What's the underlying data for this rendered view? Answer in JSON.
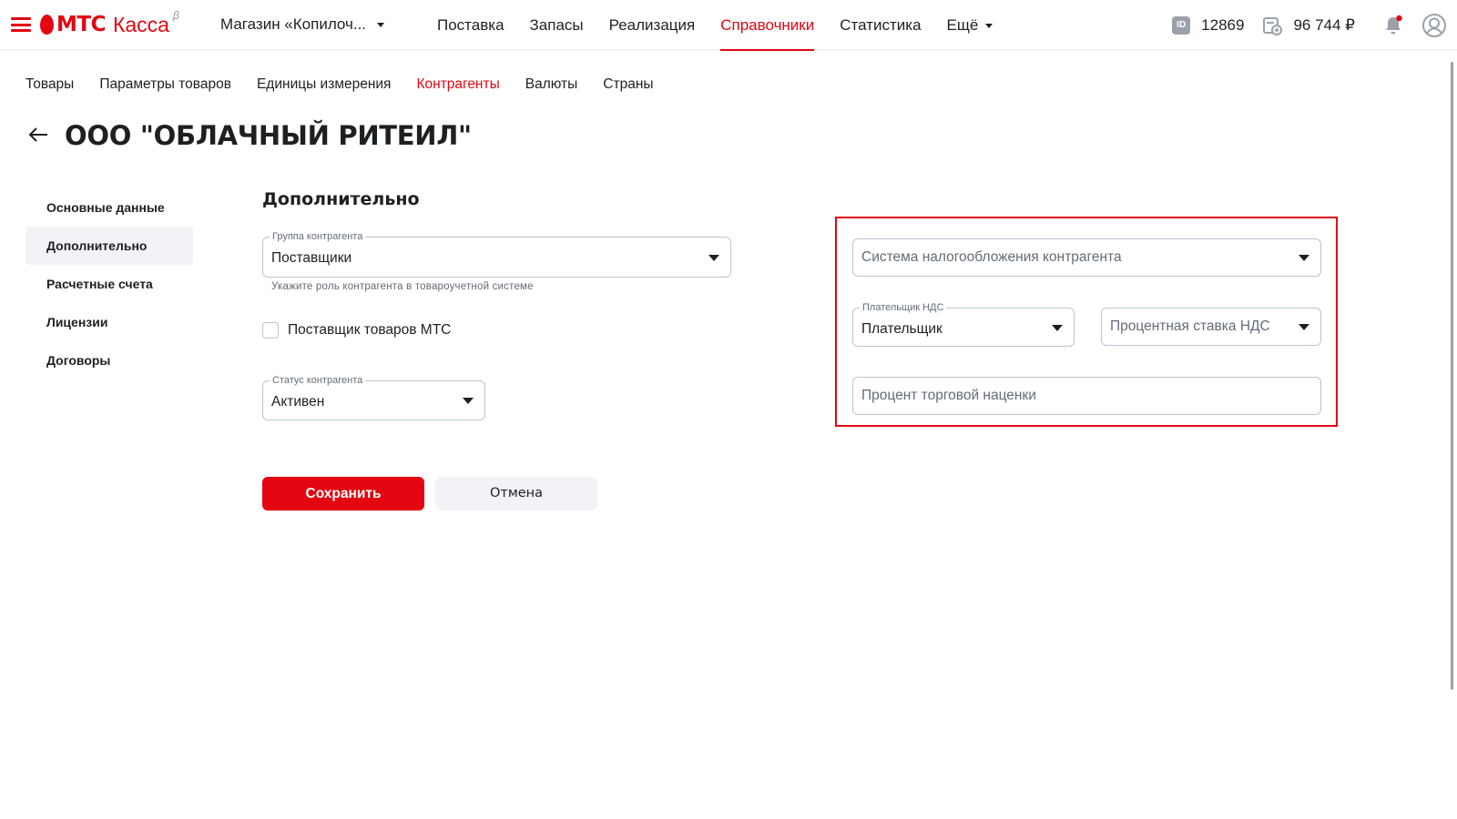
{
  "header": {
    "logo_brand": "МТС",
    "logo_product": "Касса",
    "logo_beta": "β",
    "store_name": "Магазин «Копилоч...",
    "nav": [
      {
        "label": "Поставка"
      },
      {
        "label": "Запасы"
      },
      {
        "label": "Реализация"
      },
      {
        "label": "Справочники",
        "active": true
      },
      {
        "label": "Статистика"
      },
      {
        "label": "Ещё"
      }
    ],
    "user_id": "12869",
    "balance": "96 744 ₽"
  },
  "subtabs": [
    {
      "label": "Товары"
    },
    {
      "label": "Параметры товаров"
    },
    {
      "label": "Единицы измерения"
    },
    {
      "label": "Контрагенты",
      "active": true
    },
    {
      "label": "Валюты"
    },
    {
      "label": "Страны"
    }
  ],
  "page": {
    "title": "ООО \"ОБЛАЧНЫЙ РИТЕИЛ\""
  },
  "sidemenu": [
    {
      "label": "Основные данные"
    },
    {
      "label": "Дополнительно",
      "active": true
    },
    {
      "label": "Расчетные счета"
    },
    {
      "label": "Лицензии"
    },
    {
      "label": "Договоры"
    }
  ],
  "form": {
    "section_title": "Дополнительно",
    "group": {
      "label": "Группа контрагента",
      "value": "Поставщики",
      "hint": "Укажите роль контрагента в товароучетной системе"
    },
    "mts_supplier": {
      "label": "Поставщик товаров МТС",
      "checked": false
    },
    "status": {
      "label": "Статус контрагента",
      "value": "Активен"
    },
    "tax_system": {
      "placeholder": "Система налогообложения контрагента"
    },
    "vat_payer": {
      "label": "Плательщик НДС",
      "value": "Плательщик"
    },
    "vat_rate": {
      "placeholder": "Процентная ставка НДС"
    },
    "markup": {
      "placeholder": "Процент торговой наценки"
    },
    "save_label": "Сохранить",
    "cancel_label": "Отмена"
  },
  "colors": {
    "accent": "#e30611",
    "highlight": "#e30611",
    "border": "#bcc3d0",
    "muted_text": "#626c77"
  }
}
